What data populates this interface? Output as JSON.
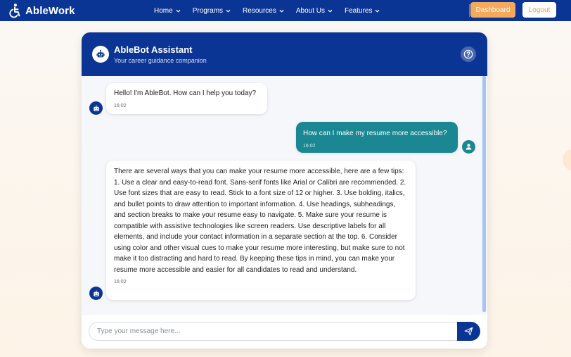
{
  "brand": {
    "name": "AbleWork",
    "icon": "wheelchair-icon"
  },
  "nav": {
    "items": [
      {
        "label": "Home"
      },
      {
        "label": "Programs"
      },
      {
        "label": "Resources"
      },
      {
        "label": "About Us"
      },
      {
        "label": "Features"
      }
    ],
    "dashboard_label": "Dashboard",
    "logout_label": "Logout"
  },
  "chat": {
    "title": "AbleBot Assistant",
    "subtitle": "Your career guidance companion",
    "help_icon": "help-icon",
    "messages": [
      {
        "sender": "bot",
        "text": "Hello! I'm AbleBot. How can I help you today?",
        "time": "16:02"
      },
      {
        "sender": "user",
        "text": "How can I make my resume more accessible?",
        "time": "16:02"
      },
      {
        "sender": "bot",
        "text": "There are several ways that you can make your resume more accessible, here are a few tips: 1. Use a clear and easy-to-read font. Sans-serif fonts like Arial or Calibri are recommended. 2. Use font sizes that are easy to read. Stick to a font size of 12 or higher. 3. Use bolding, italics, and bullet points to draw attention to important information. 4. Use headings, subheadings, and section breaks to make your resume easy to navigate. 5. Make sure your resume is compatible with assistive technologies like screen readers. Use descriptive labels for all elements, and include your contact information in a separate section at the top. 6. Consider using color and other visual cues to make your resume more interesting, but make sure to not make it too distracting and hard to read. By keeping these tips in mind, you can make your resume more accessible and easier for all candidates to read and understand.",
        "time": "16:02"
      }
    ],
    "input_placeholder": "Type your message here..."
  },
  "colors": {
    "primary": "#0b3595",
    "user_bubble": "#1a8793",
    "dashboard": "#f6a95b",
    "logout_text": "#f39a48"
  }
}
